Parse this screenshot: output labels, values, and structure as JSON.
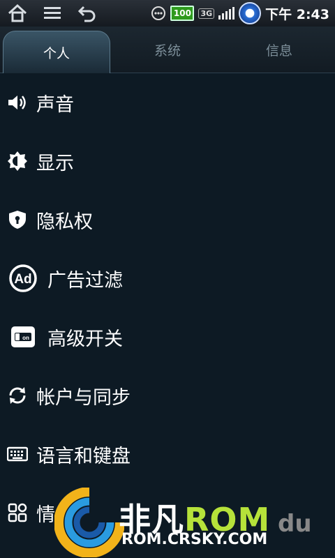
{
  "statusbar": {
    "battery": "100",
    "network": "3G",
    "time": "下午 2:43"
  },
  "tabs": [
    {
      "label": "个人"
    },
    {
      "label": "系统"
    },
    {
      "label": "信息"
    }
  ],
  "items": [
    {
      "label": "声音",
      "icon": "speaker-icon"
    },
    {
      "label": "显示",
      "icon": "brightness-icon"
    },
    {
      "label": "隐私权",
      "icon": "shield-lock-icon"
    },
    {
      "label": "广告过滤",
      "icon": "ad-block-icon"
    },
    {
      "label": "高级开关",
      "icon": "toggle-on-icon"
    },
    {
      "label": "帐户与同步",
      "icon": "sync-icon"
    },
    {
      "label": "语言和键盘",
      "icon": "keyboard-icon"
    },
    {
      "label": "情",
      "icon": "apps-grid-icon"
    }
  ],
  "watermark": {
    "brand": "非凡",
    "brand_rom": "ROM",
    "url": "ROM.CRSKY.COM",
    "du": "du"
  }
}
